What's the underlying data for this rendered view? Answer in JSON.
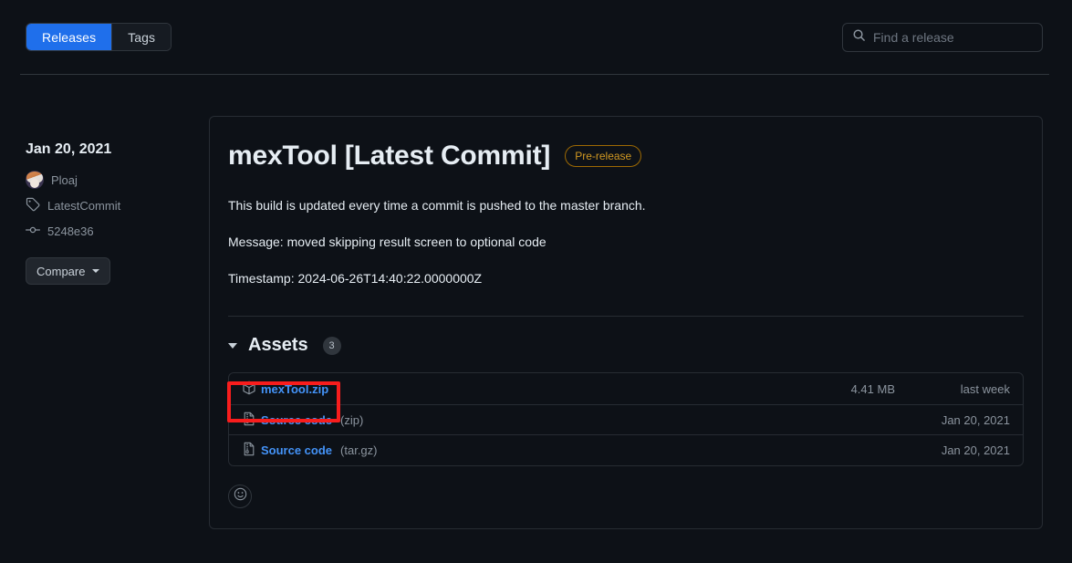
{
  "topbar": {
    "tabs": [
      {
        "label": "Releases",
        "active": true
      },
      {
        "label": "Tags",
        "active": false
      }
    ],
    "search": {
      "placeholder": "Find a release",
      "value": "",
      "icon": "search-icon"
    }
  },
  "sidebar": {
    "date": "Jan 20, 2021",
    "author": {
      "name": "Ploaj",
      "avatar_icon": "avatar"
    },
    "tag": {
      "label": "LatestCommit",
      "icon": "tag-icon"
    },
    "commit": {
      "label": "5248e36",
      "icon": "git-commit-icon"
    },
    "compare_button": {
      "label": "Compare",
      "icon": "chevron-down-icon"
    }
  },
  "release": {
    "title": "mexTool [Latest Commit]",
    "badge": "Pre-release",
    "paragraphs": [
      "This build is updated every time a commit is pushed to the master branch.",
      "Message: moved skipping result screen to optional code",
      "Timestamp: 2024-06-26T14:40:22.0000000Z"
    ]
  },
  "assets": {
    "heading": "Assets",
    "count": "3",
    "collapse_icon": "triangle-down-icon",
    "rows": [
      {
        "name": "mexTool.zip",
        "suffix": "",
        "icon": "package-icon",
        "size": "4.41 MB",
        "date": "last week",
        "highlighted": true
      },
      {
        "name": "Source code",
        "suffix": "(zip)",
        "icon": "file-zip-icon",
        "size": "",
        "date": "Jan 20, 2021",
        "highlighted": false
      },
      {
        "name": "Source code",
        "suffix": "(tar.gz)",
        "icon": "file-zip-icon",
        "size": "",
        "date": "Jan 20, 2021",
        "highlighted": false
      }
    ]
  },
  "reaction": {
    "icon": "smiley-icon"
  },
  "colors": {
    "page_bg": "#0d1117",
    "accent_blue": "#1f6feb",
    "link_blue": "#4493f8",
    "border": "#30363d",
    "muted_text": "#8b949e",
    "prerelease": "#d29922",
    "annotation_red": "#f81d1d"
  }
}
